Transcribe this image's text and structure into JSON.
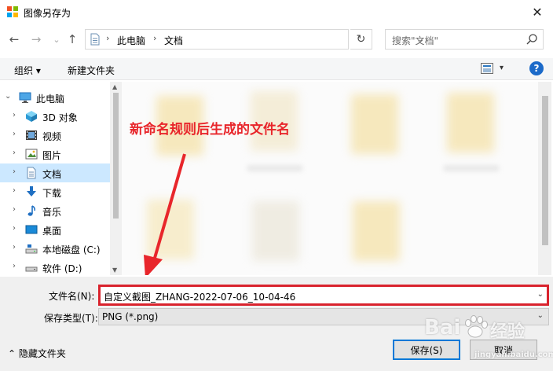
{
  "window": {
    "title": "图像另存为",
    "close": "✕"
  },
  "nav": {
    "back": "←",
    "forward": "→",
    "recent": "⌄",
    "up": "↑",
    "breadcrumb": [
      "此电脑",
      "文档"
    ],
    "refresh": "↻",
    "search_placeholder": "搜索\"文档\""
  },
  "toolbar": {
    "organize": "组织 ▾",
    "new_folder": "新建文件夹",
    "help": "?"
  },
  "sidebar": {
    "items": [
      {
        "label": "此电脑",
        "icon": "pc-icon",
        "expanded": true
      },
      {
        "label": "3D 对象",
        "icon": "3d-objects-icon"
      },
      {
        "label": "视频",
        "icon": "video-icon"
      },
      {
        "label": "图片",
        "icon": "pictures-icon"
      },
      {
        "label": "文档",
        "icon": "documents-icon",
        "selected": true
      },
      {
        "label": "下载",
        "icon": "download-icon"
      },
      {
        "label": "音乐",
        "icon": "music-icon"
      },
      {
        "label": "桌面",
        "icon": "desktop-icon"
      },
      {
        "label": "本地磁盘 (C:)",
        "icon": "drive-icon"
      },
      {
        "label": "软件 (D:)",
        "icon": "drive-icon"
      }
    ]
  },
  "content": {
    "annotation": "新命名规则后生成的文件名",
    "annotation_color": "#e8262b"
  },
  "form": {
    "filename_label": "文件名(N):",
    "filename_value": "自定义截图_ZHANG-2022-07-06_10-04-46",
    "filetype_label": "保存类型(T):",
    "filetype_value": "PNG (*.png)",
    "hide_folders": "隐藏文件夹",
    "save_button": "保存(S)",
    "cancel_button": "取消"
  },
  "watermark": {
    "brand": "Bai",
    "suffix": "经验",
    "domain": "jingyan.baidu.com"
  }
}
